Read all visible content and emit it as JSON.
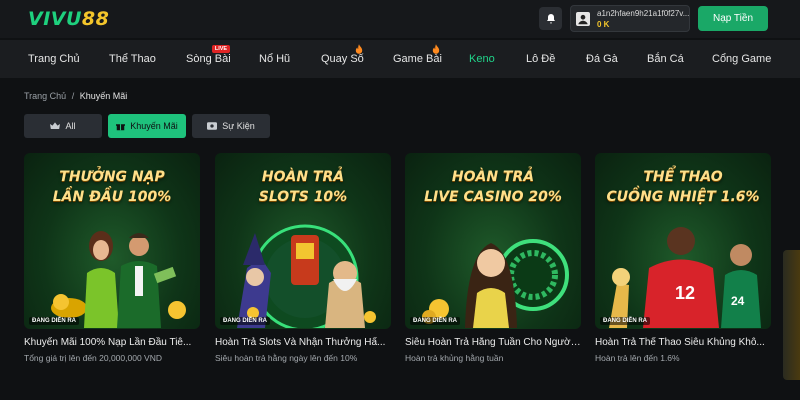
{
  "header": {
    "logo_main": "VIVU",
    "logo_num": "88",
    "username": "a1n2hfaen9h21a1f0f27v...",
    "balance": "0 K",
    "deposit_label": "Nạp Tiền",
    "icons": [
      "bell-icon",
      "user-icon"
    ]
  },
  "nav": {
    "items": [
      {
        "label": "Trang Chủ"
      },
      {
        "label": "Thể Thao"
      },
      {
        "label": "Sòng Bài",
        "badge": "LIVE"
      },
      {
        "label": "Nổ Hũ"
      },
      {
        "label": "Quay Số",
        "icon": "fire-icon"
      },
      {
        "label": "Game Bài",
        "icon": "fire-icon"
      },
      {
        "label": "Keno",
        "active": true
      },
      {
        "label": "Lô Đề"
      },
      {
        "label": "Đá Gà"
      },
      {
        "label": "Bắn Cá"
      },
      {
        "label": "Cổng Game"
      }
    ]
  },
  "breadcrumb": {
    "home": "Trang Chủ",
    "sep": "/",
    "current": "Khuyến Mãi"
  },
  "filters": [
    {
      "label": "All",
      "icon": "crown-icon"
    },
    {
      "label": "Khuyến Mãi",
      "icon": "gift-icon",
      "active": true
    },
    {
      "label": "Sự Kiện",
      "icon": "ticket-icon"
    }
  ],
  "promos": [
    {
      "title_line1": "THƯỞNG NẠP",
      "title_line2": "LẦN ĐẦU 100%",
      "status": "ĐANG DIỄN RA",
      "caption": "Khuyến Mãi 100% Nạp Lần Đầu Tiê...",
      "sub": "Tổng giá trị lên đến 20,000,000 VND"
    },
    {
      "title_line1": "HOÀN TRẢ",
      "title_line2": "SLOTS 10%",
      "status": "ĐANG DIỄN RA",
      "caption": "Hoàn Trả Slots Và Nhận Thưởng Hấ...",
      "sub": "Siêu hoàn trả hằng ngày lên đến 10%"
    },
    {
      "title_line1": "HOÀN TRẢ",
      "title_line2": "LIVE CASINO 20%",
      "status": "ĐANG DIỄN RA",
      "caption": "Siêu Hoàn Trả Hằng Tuần Cho Người...",
      "sub": "Hoàn trả khủng hằng tuần"
    },
    {
      "title_line1": "THỂ THAO",
      "title_line2": "CUỒNG NHIỆT 1.6%",
      "status": "ĐANG DIỄN RA",
      "caption": "Hoàn Trả Thể Thao Siêu Khủng Khô...",
      "sub": "Hoàn trả lên đến 1.6%"
    }
  ],
  "colors": {
    "accent": "#1ec27c",
    "brand_green": "#1ed07e",
    "brand_gold": "#f3c52b",
    "live_red": "#e02424",
    "background": "#0f1113"
  }
}
